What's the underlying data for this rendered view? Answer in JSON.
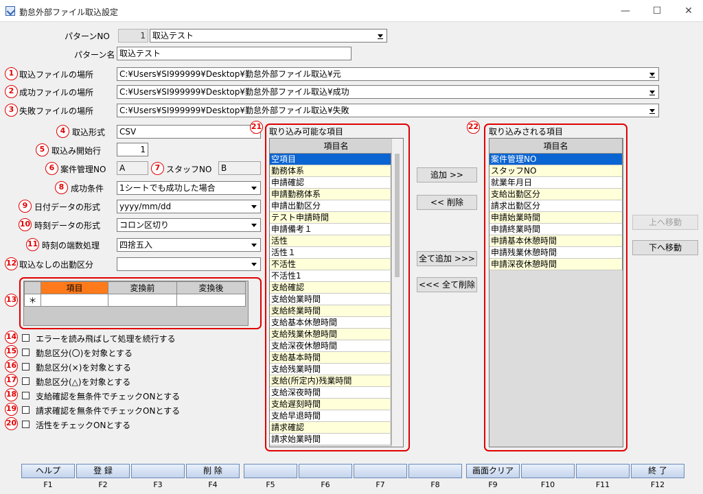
{
  "window": {
    "title": "勤怠外部ファイル取込設定",
    "minimize": "—",
    "maximize": "☐",
    "close": "✕"
  },
  "pattern_no": {
    "label": "パターンNO",
    "number": "1",
    "name": "取込テスト"
  },
  "pattern_name": {
    "label": "パターン名",
    "value": "取込テスト"
  },
  "import_location": {
    "marker": "1",
    "label": "取込ファイルの場所",
    "value": "C:¥Users¥SI999999¥Desktop¥勤怠外部ファイル取込¥元"
  },
  "success_location": {
    "marker": "2",
    "label": "成功ファイルの場所",
    "value": "C:¥Users¥SI999999¥Desktop¥勤怠外部ファイル取込¥成功"
  },
  "fail_location": {
    "marker": "3",
    "label": "失敗ファイルの場所",
    "value": "C:¥Users¥SI999999¥Desktop¥勤怠外部ファイル取込¥失敗"
  },
  "import_format": {
    "marker": "4",
    "label": "取込形式",
    "value": "CSV"
  },
  "start_row": {
    "marker": "5",
    "label": "取込み開始行",
    "value": "1"
  },
  "case_no": {
    "marker": "6",
    "label": "案件管理NO",
    "value": "A"
  },
  "staff_no": {
    "marker": "7",
    "label": "スタッフNO",
    "value": "B"
  },
  "success_condition": {
    "marker": "8",
    "label": "成功条件",
    "value": "1シートでも成功した場合"
  },
  "date_format": {
    "marker": "9",
    "label": "日付データの形式",
    "value": "yyyy/mm/dd"
  },
  "time_format": {
    "marker": "10",
    "label": "時刻データの形式",
    "value": "コロン区切り"
  },
  "rounding": {
    "marker": "11",
    "label": "時刻の端数処理",
    "value": "四捨五入"
  },
  "no_import_category": {
    "marker": "12",
    "label": "取込なしの出勤区分",
    "value": ""
  },
  "convert_table": {
    "marker": "13",
    "headers": [
      "項目",
      "変換前",
      "変換後"
    ],
    "new_row_marker": "＊"
  },
  "options": [
    {
      "marker": "14",
      "label": "エラーを読み飛ばして処理を続行する"
    },
    {
      "marker": "15",
      "label": "勤怠区分(〇)を対象とする"
    },
    {
      "marker": "16",
      "label": "勤怠区分(×)を対象とする"
    },
    {
      "marker": "17",
      "label": "勤怠区分(△)を対象とする"
    },
    {
      "marker": "18",
      "label": "支給確認を無条件でチェックONとする"
    },
    {
      "marker": "19",
      "label": "請求確認を無条件でチェックONとする"
    },
    {
      "marker": "20",
      "label": "活性をチェックONとする"
    }
  ],
  "available": {
    "marker": "21",
    "title": "取り込み可能な項目",
    "header": "項目名",
    "items": [
      "空項目",
      "勤務体系",
      "申請確認",
      "申請勤務体系",
      "申請出勤区分",
      "テスト申請時間",
      "申請備考１",
      "活性",
      "活性１",
      "不活性",
      "不活性1",
      "支給確認",
      "支給始業時間",
      "支給終業時間",
      "支給基本休憩時間",
      "支給残業休憩時間",
      "支給深夜休憩時間",
      "支給基本時間",
      "支給残業時間",
      "支給(所定内)残業時間",
      "支給深夜時間",
      "支給遅刻時間",
      "支給早退時間",
      "請求確認",
      "請求始業時間"
    ]
  },
  "imported": {
    "marker": "22",
    "title": "取り込みされる項目",
    "header": "項目名",
    "items": [
      "案件管理NO",
      "スタッフNO",
      "就業年月日",
      "支給出勤区分",
      "請求出勤区分",
      "申請始業時間",
      "申請終業時間",
      "申請基本休憩時間",
      "申請残業休憩時間",
      "申請深夜休憩時間"
    ]
  },
  "buttons": {
    "add": "追加 >>",
    "remove": "<< 削除",
    "add_all": "全て追加 >>>",
    "remove_all": "<<< 全て削除",
    "move_up": "上へ移動",
    "move_down": "下へ移動"
  },
  "fkeys": [
    {
      "key": "F1",
      "label": "ヘルプ"
    },
    {
      "key": "F2",
      "label": "登 録"
    },
    {
      "key": "F3",
      "label": ""
    },
    {
      "key": "F4",
      "label": "削 除"
    },
    {
      "key": "F5",
      "label": ""
    },
    {
      "key": "F6",
      "label": ""
    },
    {
      "key": "F7",
      "label": ""
    },
    {
      "key": "F8",
      "label": ""
    },
    {
      "key": "F9",
      "label": "画面クリア"
    },
    {
      "key": "F10",
      "label": ""
    },
    {
      "key": "F11",
      "label": ""
    },
    {
      "key": "F12",
      "label": "終 了"
    }
  ]
}
